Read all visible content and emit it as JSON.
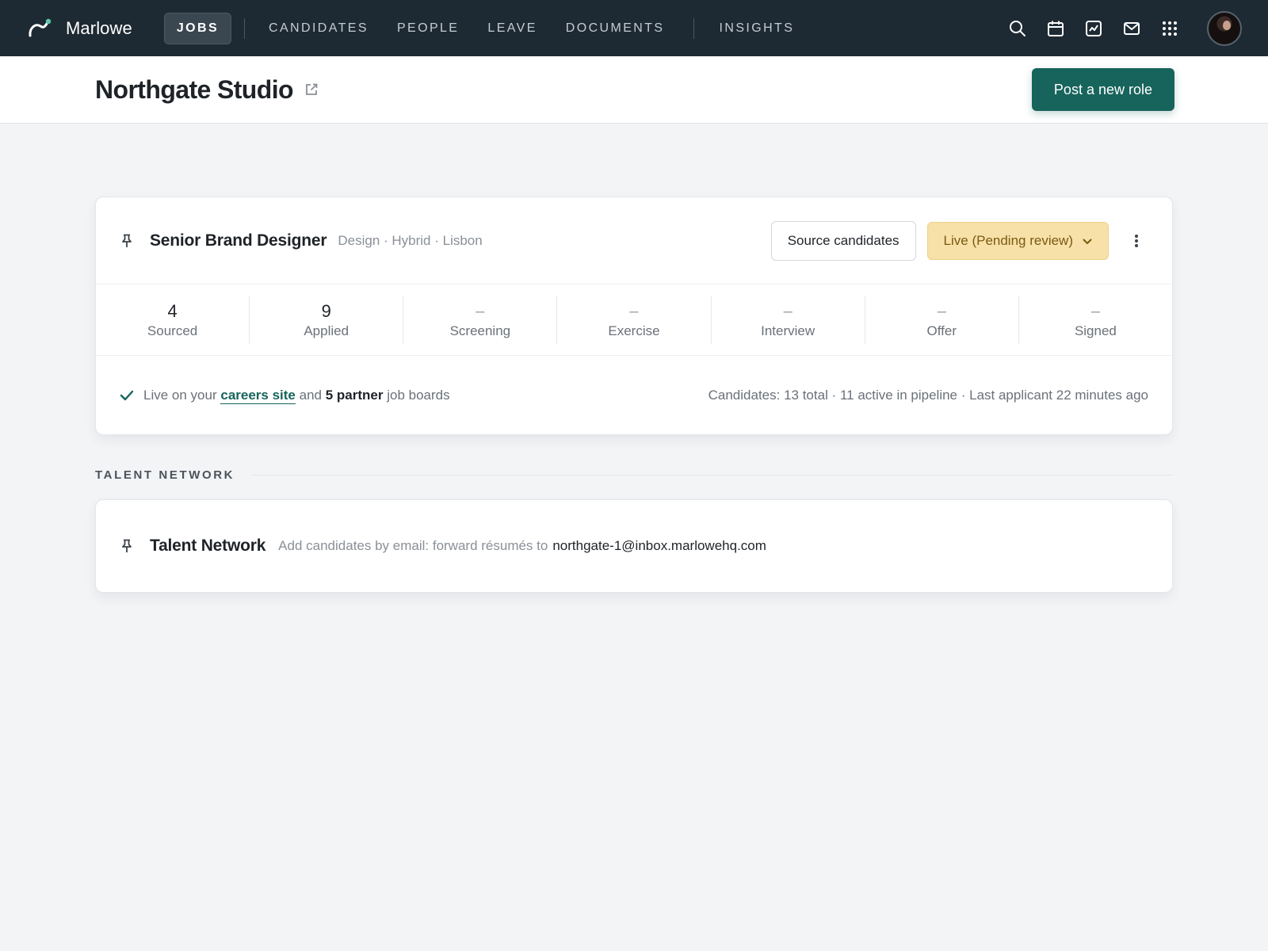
{
  "app": {
    "brand_name": "Marlowe",
    "colors": {
      "nav_bg": "#1e2a33",
      "accent": "#17645c",
      "status_bg": "#f7e1a8"
    }
  },
  "nav": {
    "items": [
      {
        "label": "JOBS",
        "active": true
      },
      {
        "label": "CANDIDATES"
      },
      {
        "label": "PEOPLE"
      },
      {
        "label": "LEAVE"
      },
      {
        "label": "DOCUMENTS"
      },
      {
        "label": "INSIGHTS"
      }
    ],
    "tools": [
      "search-icon",
      "calendar-icon",
      "chart-icon",
      "mail-icon",
      "apps-grid-icon"
    ]
  },
  "header": {
    "title": "Northgate Studio",
    "post_button": "Post a new role"
  },
  "job": {
    "title": "Senior Brand Designer",
    "meta": "Design · Hybrid · Lisbon",
    "source_button": "Source candidates",
    "status": "Live (Pending review)",
    "stages": [
      {
        "count": "4",
        "label": "Sourced"
      },
      {
        "count": "9",
        "label": "Applied"
      },
      {
        "count": "–",
        "label": "Screening"
      },
      {
        "count": "–",
        "label": "Exercise"
      },
      {
        "count": "–",
        "label": "Interview"
      },
      {
        "count": "–",
        "label": "Offer"
      },
      {
        "count": "–",
        "label": "Signed"
      }
    ],
    "footer": {
      "live_prefix": "Live on your",
      "careers_link": "careers site",
      "and": "and",
      "partner_count": "5 partner",
      "boards_suffix": "job boards",
      "summary": "Candidates: 13 total · 11 active in pipeline · Last applicant 22 minutes ago"
    }
  },
  "talent": {
    "section_label": "TALENT NETWORK",
    "title": "Talent Network",
    "description": "Add candidates by email: forward résumés to",
    "email": "northgate-1@inbox.marlowehq.com"
  }
}
